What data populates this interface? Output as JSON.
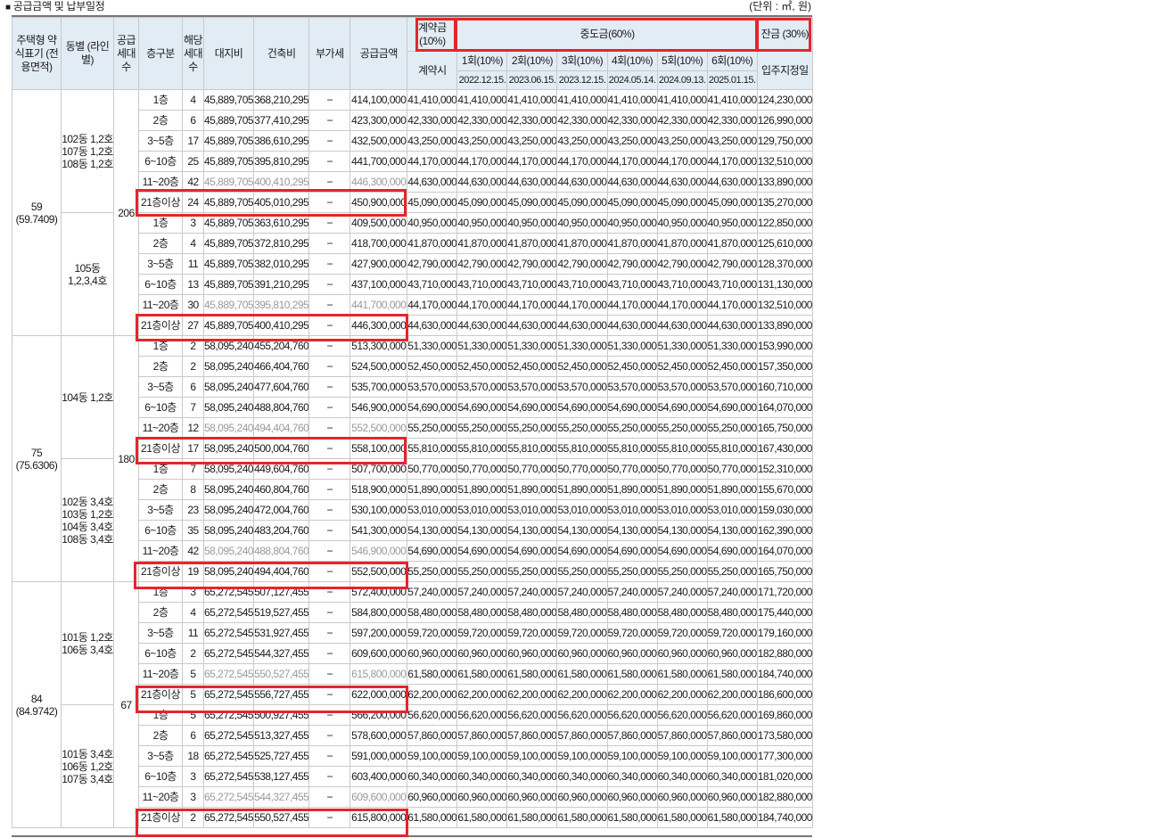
{
  "caption": "공급금액 및 납부일정",
  "caption_bullet": "■",
  "unit": "(단위 : ㎡, 원)",
  "headers": {
    "type": "주택형 약식표기 (전용면적)",
    "building": "동별 (라인별)",
    "supply_units": "공급 세대 수",
    "floor": "층구분",
    "units": "해당 세대 수",
    "land": "대지비",
    "construction": "건축비",
    "vat": "부가세",
    "price": "공급금액",
    "deposit": "계약금 (10%)",
    "interim": "중도금(60%)",
    "balance": "잔금 (30%)",
    "contract_time": "계약시",
    "install_1": "1회(10%)",
    "install_2": "2회(10%)",
    "install_3": "3회(10%)",
    "install_4": "4회(10%)",
    "install_5": "5회(10%)",
    "install_6": "6회(10%)",
    "date_1": "2022.12.15.",
    "date_2": "2023.06.15.",
    "date_3": "2023.12.15.",
    "date_4": "2024.05.14.",
    "date_5": "2024.09.13.",
    "date_6": "2025.01.15.",
    "move_in": "입주지정일"
  },
  "sections": [
    {
      "type": "59 (59.7409)",
      "supply_units": "206",
      "groups": [
        {
          "building": "102동 1,2호 107동 1,2호 108동 1,2호",
          "rows": [
            [
              "1층",
              "4",
              "45,889,705",
              "368,210,295",
              "−",
              "414,100,000",
              "41,410,000",
              "41,410,000",
              "41,410,000",
              "41,410,000",
              "41,410,000",
              "41,410,000",
              "41,410,000",
              "124,230,000"
            ],
            [
              "2층",
              "6",
              "45,889,705",
              "377,410,295",
              "−",
              "423,300,000",
              "42,330,000",
              "42,330,000",
              "42,330,000",
              "42,330,000",
              "42,330,000",
              "42,330,000",
              "42,330,000",
              "126,990,000"
            ],
            [
              "3~5층",
              "17",
              "45,889,705",
              "386,610,295",
              "−",
              "432,500,000",
              "43,250,000",
              "43,250,000",
              "43,250,000",
              "43,250,000",
              "43,250,000",
              "43,250,000",
              "43,250,000",
              "129,750,000"
            ],
            [
              "6~10층",
              "25",
              "45,889,705",
              "395,810,295",
              "−",
              "441,700,000",
              "44,170,000",
              "44,170,000",
              "44,170,000",
              "44,170,000",
              "44,170,000",
              "44,170,000",
              "44,170,000",
              "132,510,000"
            ],
            [
              "11~20층",
              "42",
              "45,889,705",
              "400,410,295",
              "−",
              "446,300,000",
              "44,630,000",
              "44,630,000",
              "44,630,000",
              "44,630,000",
              "44,630,000",
              "44,630,000",
              "44,630,000",
              "133,890,000"
            ],
            [
              "21층이상",
              "24",
              "45,889,705",
              "405,010,295",
              "−",
              "450,900,000",
              "45,090,000",
              "45,090,000",
              "45,090,000",
              "45,090,000",
              "45,090,000",
              "45,090,000",
              "45,090,000",
              "135,270,000"
            ]
          ]
        },
        {
          "building": "105동 1,2,3,4호",
          "rows": [
            [
              "1층",
              "3",
              "45,889,705",
              "363,610,295",
              "−",
              "409,500,000",
              "40,950,000",
              "40,950,000",
              "40,950,000",
              "40,950,000",
              "40,950,000",
              "40,950,000",
              "40,950,000",
              "122,850,000"
            ],
            [
              "2층",
              "4",
              "45,889,705",
              "372,810,295",
              "−",
              "418,700,000",
              "41,870,000",
              "41,870,000",
              "41,870,000",
              "41,870,000",
              "41,870,000",
              "41,870,000",
              "41,870,000",
              "125,610,000"
            ],
            [
              "3~5층",
              "11",
              "45,889,705",
              "382,010,295",
              "−",
              "427,900,000",
              "42,790,000",
              "42,790,000",
              "42,790,000",
              "42,790,000",
              "42,790,000",
              "42,790,000",
              "42,790,000",
              "128,370,000"
            ],
            [
              "6~10층",
              "13",
              "45,889,705",
              "391,210,295",
              "−",
              "437,100,000",
              "43,710,000",
              "43,710,000",
              "43,710,000",
              "43,710,000",
              "43,710,000",
              "43,710,000",
              "43,710,000",
              "131,130,000"
            ],
            [
              "11~20층",
              "30",
              "45,889,705",
              "395,810,295",
              "−",
              "441,700,000",
              "44,170,000",
              "44,170,000",
              "44,170,000",
              "44,170,000",
              "44,170,000",
              "44,170,000",
              "44,170,000",
              "132,510,000"
            ],
            [
              "21층이상",
              "27",
              "45,889,705",
              "400,410,295",
              "−",
              "446,300,000",
              "44,630,000",
              "44,630,000",
              "44,630,000",
              "44,630,000",
              "44,630,000",
              "44,630,000",
              "44,630,000",
              "133,890,000"
            ]
          ]
        }
      ]
    },
    {
      "type": "75 (75.6306)",
      "supply_units": "180",
      "groups": [
        {
          "building": "104동 1,2호",
          "rows": [
            [
              "1층",
              "2",
              "58,095,240",
              "455,204,760",
              "−",
              "513,300,000",
              "51,330,000",
              "51,330,000",
              "51,330,000",
              "51,330,000",
              "51,330,000",
              "51,330,000",
              "51,330,000",
              "153,990,000"
            ],
            [
              "2층",
              "2",
              "58,095,240",
              "466,404,760",
              "−",
              "524,500,000",
              "52,450,000",
              "52,450,000",
              "52,450,000",
              "52,450,000",
              "52,450,000",
              "52,450,000",
              "52,450,000",
              "157,350,000"
            ],
            [
              "3~5층",
              "6",
              "58,095,240",
              "477,604,760",
              "−",
              "535,700,000",
              "53,570,000",
              "53,570,000",
              "53,570,000",
              "53,570,000",
              "53,570,000",
              "53,570,000",
              "53,570,000",
              "160,710,000"
            ],
            [
              "6~10층",
              "7",
              "58,095,240",
              "488,804,760",
              "−",
              "546,900,000",
              "54,690,000",
              "54,690,000",
              "54,690,000",
              "54,690,000",
              "54,690,000",
              "54,690,000",
              "54,690,000",
              "164,070,000"
            ],
            [
              "11~20층",
              "12",
              "58,095,240",
              "494,404,760",
              "−",
              "552,500,000",
              "55,250,000",
              "55,250,000",
              "55,250,000",
              "55,250,000",
              "55,250,000",
              "55,250,000",
              "55,250,000",
              "165,750,000"
            ],
            [
              "21층이상",
              "17",
              "58,095,240",
              "500,004,760",
              "−",
              "558,100,000",
              "55,810,000",
              "55,810,000",
              "55,810,000",
              "55,810,000",
              "55,810,000",
              "55,810,000",
              "55,810,000",
              "167,430,000"
            ]
          ]
        },
        {
          "building": "102동 3,4호 103동 1,2호 104동 3,4호 108동 3,4호",
          "rows": [
            [
              "1층",
              "7",
              "58,095,240",
              "449,604,760",
              "−",
              "507,700,000",
              "50,770,000",
              "50,770,000",
              "50,770,000",
              "50,770,000",
              "50,770,000",
              "50,770,000",
              "50,770,000",
              "152,310,000"
            ],
            [
              "2층",
              "8",
              "58,095,240",
              "460,804,760",
              "−",
              "518,900,000",
              "51,890,000",
              "51,890,000",
              "51,890,000",
              "51,890,000",
              "51,890,000",
              "51,890,000",
              "51,890,000",
              "155,670,000"
            ],
            [
              "3~5층",
              "23",
              "58,095,240",
              "472,004,760",
              "−",
              "530,100,000",
              "53,010,000",
              "53,010,000",
              "53,010,000",
              "53,010,000",
              "53,010,000",
              "53,010,000",
              "53,010,000",
              "159,030,000"
            ],
            [
              "6~10층",
              "35",
              "58,095,240",
              "483,204,760",
              "−",
              "541,300,000",
              "54,130,000",
              "54,130,000",
              "54,130,000",
              "54,130,000",
              "54,130,000",
              "54,130,000",
              "54,130,000",
              "162,390,000"
            ],
            [
              "11~20층",
              "42",
              "58,095,240",
              "488,804,760",
              "−",
              "546,900,000",
              "54,690,000",
              "54,690,000",
              "54,690,000",
              "54,690,000",
              "54,690,000",
              "54,690,000",
              "54,690,000",
              "164,070,000"
            ],
            [
              "21층이상",
              "19",
              "58,095,240",
              "494,404,760",
              "−",
              "552,500,000",
              "55,250,000",
              "55,250,000",
              "55,250,000",
              "55,250,000",
              "55,250,000",
              "55,250,000",
              "55,250,000",
              "165,750,000"
            ]
          ]
        }
      ]
    },
    {
      "type": "84 (84.9742)",
      "supply_units": "67",
      "groups": [
        {
          "building": "101동 1,2호 106동 3,4호",
          "rows": [
            [
              "1층",
              "3",
              "65,272,545",
              "507,127,455",
              "−",
              "572,400,000",
              "57,240,000",
              "57,240,000",
              "57,240,000",
              "57,240,000",
              "57,240,000",
              "57,240,000",
              "57,240,000",
              "171,720,000"
            ],
            [
              "2층",
              "4",
              "65,272,545",
              "519,527,455",
              "−",
              "584,800,000",
              "58,480,000",
              "58,480,000",
              "58,480,000",
              "58,480,000",
              "58,480,000",
              "58,480,000",
              "58,480,000",
              "175,440,000"
            ],
            [
              "3~5층",
              "11",
              "65,272,545",
              "531,927,455",
              "−",
              "597,200,000",
              "59,720,000",
              "59,720,000",
              "59,720,000",
              "59,720,000",
              "59,720,000",
              "59,720,000",
              "59,720,000",
              "179,160,000"
            ],
            [
              "6~10층",
              "2",
              "65,272,545",
              "544,327,455",
              "−",
              "609,600,000",
              "60,960,000",
              "60,960,000",
              "60,960,000",
              "60,960,000",
              "60,960,000",
              "60,960,000",
              "60,960,000",
              "182,880,000"
            ],
            [
              "11~20층",
              "5",
              "65,272,545",
              "550,527,455",
              "−",
              "615,800,000",
              "61,580,000",
              "61,580,000",
              "61,580,000",
              "61,580,000",
              "61,580,000",
              "61,580,000",
              "61,580,000",
              "184,740,000"
            ],
            [
              "21층이상",
              "5",
              "65,272,545",
              "556,727,455",
              "−",
              "622,000,000",
              "62,200,000",
              "62,200,000",
              "62,200,000",
              "62,200,000",
              "62,200,000",
              "62,200,000",
              "62,200,000",
              "186,600,000"
            ]
          ]
        },
        {
          "building": "101동 3,4호 106동 1,2호 107동 3,4호",
          "rows": [
            [
              "1층",
              "5",
              "65,272,545",
              "500,927,455",
              "−",
              "566,200,000",
              "56,620,000",
              "56,620,000",
              "56,620,000",
              "56,620,000",
              "56,620,000",
              "56,620,000",
              "56,620,000",
              "169,860,000"
            ],
            [
              "2층",
              "6",
              "65,272,545",
              "513,327,455",
              "−",
              "578,600,000",
              "57,860,000",
              "57,860,000",
              "57,860,000",
              "57,860,000",
              "57,860,000",
              "57,860,000",
              "57,860,000",
              "173,580,000"
            ],
            [
              "3~5층",
              "18",
              "65,272,545",
              "525,727,455",
              "−",
              "591,000,000",
              "59,100,000",
              "59,100,000",
              "59,100,000",
              "59,100,000",
              "59,100,000",
              "59,100,000",
              "59,100,000",
              "177,300,000"
            ],
            [
              "6~10층",
              "3",
              "65,272,545",
              "538,127,455",
              "−",
              "603,400,000",
              "60,340,000",
              "60,340,000",
              "60,340,000",
              "60,340,000",
              "60,340,000",
              "60,340,000",
              "60,340,000",
              "181,020,000"
            ],
            [
              "11~20층",
              "3",
              "65,272,545",
              "544,327,455",
              "−",
              "609,600,000",
              "60,960,000",
              "60,960,000",
              "60,960,000",
              "60,960,000",
              "60,960,000",
              "60,960,000",
              "60,960,000",
              "182,880,000"
            ],
            [
              "21층이상",
              "2",
              "65,272,545",
              "550,527,455",
              "−",
              "615,800,000",
              "61,580,000",
              "61,580,000",
              "61,580,000",
              "61,580,000",
              "61,580,000",
              "61,580,000",
              "61,580,000",
              "184,740,000"
            ]
          ]
        }
      ]
    }
  ]
}
